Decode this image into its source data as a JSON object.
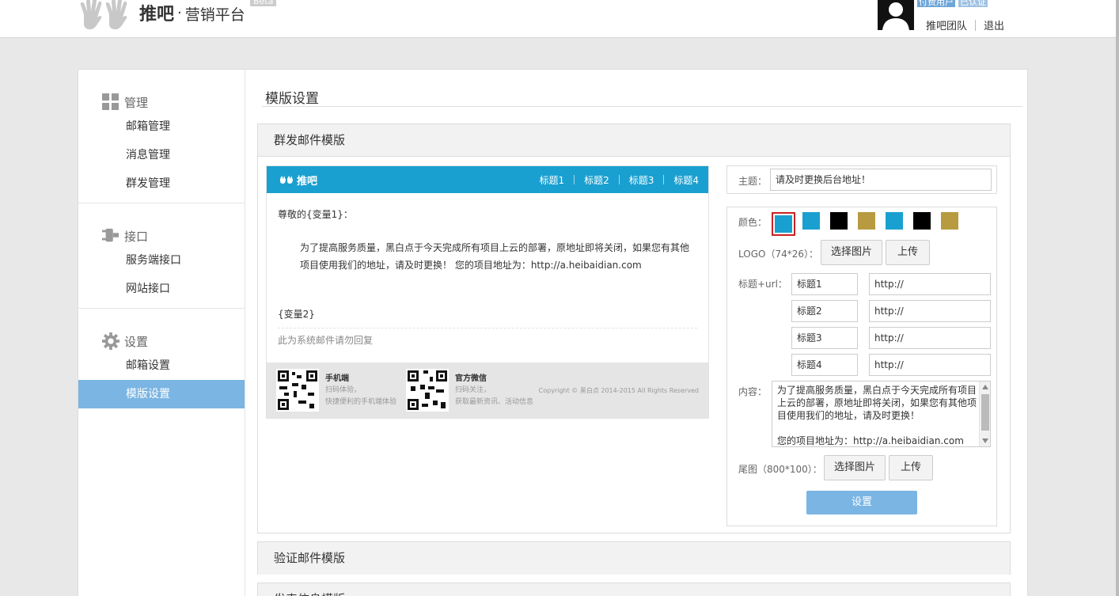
{
  "header": {
    "brand": "推吧",
    "dot": "·",
    "subtitle": "营销平台",
    "beta": "Beta",
    "badge_user": "付费用户",
    "badge_verified": "已认证",
    "team_link": "推吧团队",
    "logout": "退出"
  },
  "page": {
    "title": "模版设置"
  },
  "sidebar": {
    "groups": [
      {
        "label": "管理",
        "icon": "grid-icon",
        "items": [
          "邮箱管理",
          "消息管理",
          "群发管理"
        ]
      },
      {
        "label": "接口",
        "icon": "plug-icon",
        "items": [
          "服务端接口",
          "网站接口"
        ]
      },
      {
        "label": "设置",
        "icon": "gear-icon",
        "items": [
          "邮箱设置",
          "模版设置"
        ]
      }
    ],
    "active_item": "模版设置"
  },
  "panels": {
    "mass_mail": "群发邮件模版",
    "verify_mail": "验证邮件模版",
    "third": "发表信息模版"
  },
  "preview": {
    "logo": "推吧",
    "nav": [
      "标题1",
      "标题2",
      "标题3",
      "标题4"
    ],
    "greeting": "尊敬的{变量1}：",
    "body": "为了提高服务质量，黑白点于今天完成所有项目上云的部署，原地址即将关闭，如果您有其他项目使用我们的地址，请及时更换！ 您的项目地址为：http://a.heibaidian.com",
    "var2": "{变量2}",
    "note": "此为系统邮件请勿回复",
    "footer": {
      "mobile_title": "手机端",
      "mobile_l1": "扫码体验，",
      "mobile_l2": "快捷便利的手机端体验",
      "wechat_title": "官方微信",
      "wechat_l1": "扫码关注，",
      "wechat_l2": "获取最新资讯、活动信息",
      "copyright": "Copyright © 黑白点 2014-2015 All Rights Reserved"
    }
  },
  "settings": {
    "subject_label": "主题：",
    "subject_value": "请及时更换后台地址！",
    "color_label": "颜色：",
    "colors": [
      "#1aa0d0",
      "#1aa0d0",
      "#000000",
      "#b89a40",
      "#1aa0d0",
      "#000000",
      "#b89a40"
    ],
    "logo_label": "LOGO（74*26）：",
    "choose_image": "选择图片",
    "upload": "上传",
    "title_url_label": "标题+url：",
    "rows": [
      {
        "title": "标题1",
        "url": "http://"
      },
      {
        "title": "标题2",
        "url": "http://"
      },
      {
        "title": "标题3",
        "url": "http://"
      },
      {
        "title": "标题4",
        "url": "http://"
      }
    ],
    "content_label": "内容：",
    "content_p1": "为了提高服务质量，黑白点于今天完成所有项目上云的部署，原地址即将关闭，如果您有其他项目使用我们的地址，请及时更换！",
    "content_p2": "您的项目地址为：http://a.heibaidian.com",
    "footer_label": "尾图（800*100）：",
    "submit": "设置"
  }
}
